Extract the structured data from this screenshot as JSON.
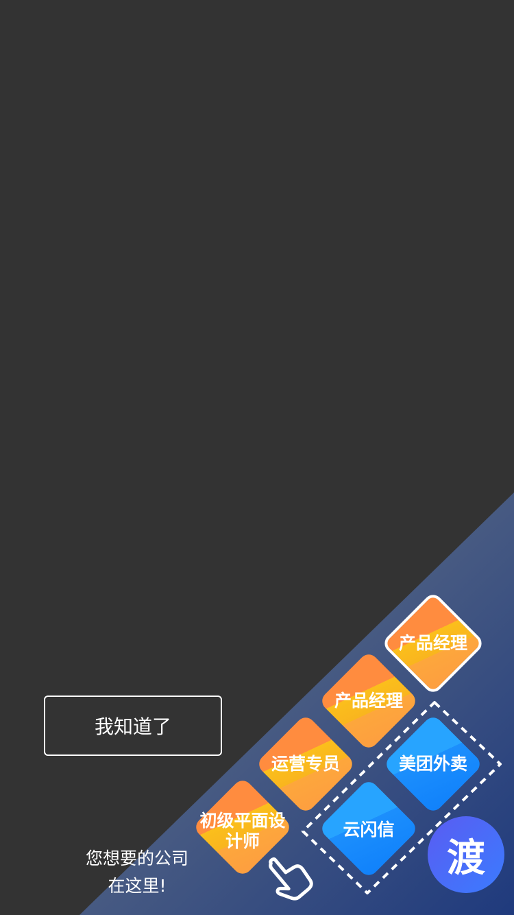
{
  "guide": {
    "ok_label": "我知道了",
    "hint_line1": "您想要的公司",
    "hint_line2": "在这里!"
  },
  "tiles": [
    {
      "label": "产品经理",
      "color": "orange",
      "highlighted": true
    },
    {
      "label": "产品经理",
      "color": "orange",
      "highlighted": false
    },
    {
      "label": "运营专员",
      "color": "orange",
      "highlighted": false
    },
    {
      "label": "初级平面设计师",
      "color": "orange",
      "highlighted": false
    },
    {
      "label": "美团外卖",
      "color": "blue",
      "highlighted": false
    },
    {
      "label": "云闪信",
      "color": "blue",
      "highlighted": false
    }
  ],
  "logo": {
    "glyph": "渡"
  },
  "icons": {
    "pointer": "hand-pointer-icon"
  },
  "colors": {
    "overlay": "#333333",
    "panel_top": "#5c6b86",
    "panel_bottom": "#223b7a",
    "tile_orange": "#fbbf1c",
    "tile_blue": "#1c8ffc",
    "logo_bg": "#4a6cf8"
  }
}
